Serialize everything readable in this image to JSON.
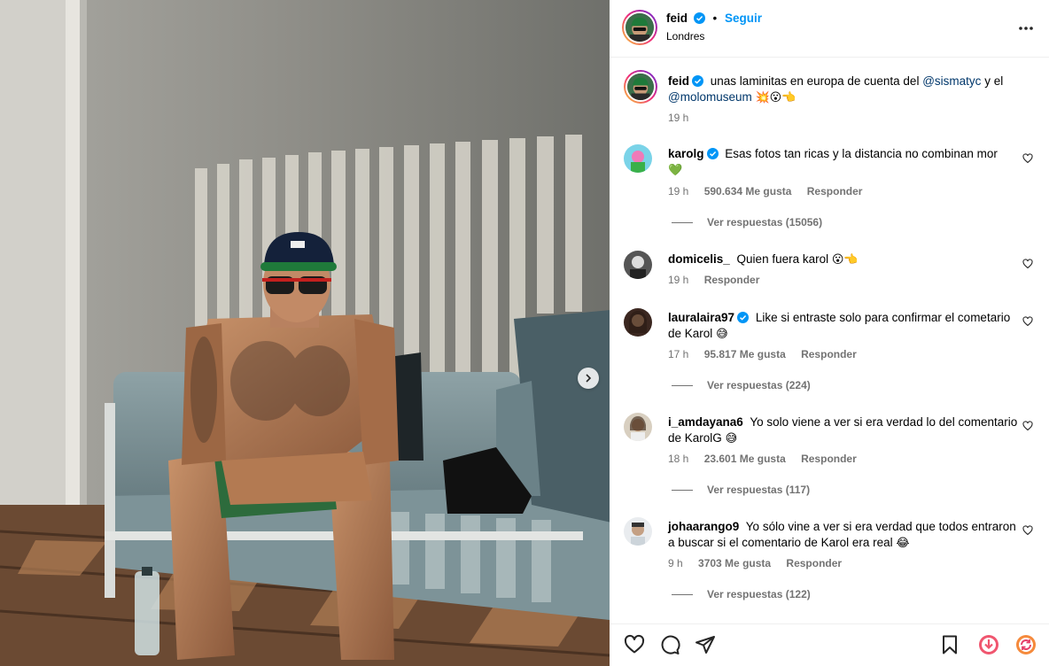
{
  "post": {
    "author": "feid",
    "follow_label": "Seguir",
    "separator": "•",
    "location": "Londres",
    "caption": {
      "user": "feid",
      "text_before": "unas laminitas en europa de cuenta del",
      "mention1": "@sismatyc",
      "text_mid": "y el",
      "mention2": "@molomuseum",
      "emojis": "💥😮👈",
      "time": "19 h"
    }
  },
  "comments": [
    {
      "user": "karolg",
      "verified": true,
      "text": "Esas fotos tan ricas y la distancia no combinan mor",
      "emoji": "💚",
      "time": "19 h",
      "likes": "590.634 Me gusta",
      "reply": "Responder",
      "view_replies": "Ver respuestas (15056)"
    },
    {
      "user": "domicelis_",
      "verified": false,
      "text": "Quien fuera karol",
      "emoji": "😮👈",
      "time": "19 h",
      "likes": "",
      "reply": "Responder",
      "view_replies": ""
    },
    {
      "user": "lauralaira97",
      "verified": true,
      "text": "Like si entraste solo para confirmar el cometario de Karol",
      "emoji": "😅",
      "time": "17 h",
      "likes": "95.817 Me gusta",
      "reply": "Responder",
      "view_replies": "Ver respuestas (224)"
    },
    {
      "user": "i_amdayana6",
      "verified": false,
      "text": "Yo solo viene a ver si era verdad lo del comentario de KarolG",
      "emoji": "😅",
      "time": "18 h",
      "likes": "23.601 Me gusta",
      "reply": "Responder",
      "view_replies": "Ver respuestas (117)"
    },
    {
      "user": "johaarango9",
      "verified": false,
      "text": "Yo sólo vine a ver si era verdad que todos entraron a buscar si el comentario de Karol era real",
      "emoji": "😂",
      "time": "9 h",
      "likes": "3703 Me gusta",
      "reply": "Responder",
      "view_replies": "Ver respuestas (122)"
    }
  ],
  "icons": {
    "more": "more-options-icon",
    "like": "heart-icon",
    "comment": "comment-icon",
    "share": "share-icon",
    "save": "bookmark-icon",
    "next": "chevron-right-icon"
  },
  "colors": {
    "accent": "#0095f6",
    "verified": "#0095f6",
    "mention": "#00376b",
    "muted": "#737373"
  }
}
